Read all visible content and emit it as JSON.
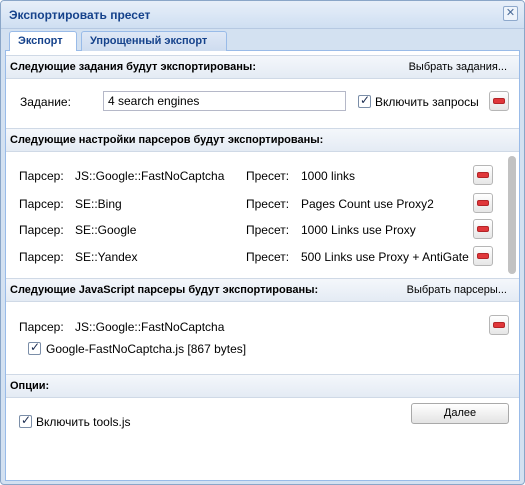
{
  "window": {
    "title": "Экспортировать пресет",
    "close_glyph": "✕"
  },
  "tabs": [
    {
      "label": "Экспорт",
      "active": true
    },
    {
      "label": "Упрощенный экспорт",
      "active": false
    }
  ],
  "tasks_section": {
    "title": "Следующие задания будут экспортированы:",
    "link": "Выбрать задания...",
    "task_label": "Задание:",
    "task_value": "4 search engines",
    "include_requests_label": "Включить запросы",
    "include_requests_checked": true
  },
  "parsers_section": {
    "title": "Следующие настройки парсеров будут экспортированы:",
    "parser_label": "Парсер:",
    "preset_label": "Пресет:",
    "rows": [
      {
        "parser": "JS::Google::FastNoCaptcha",
        "preset": "1000 links"
      },
      {
        "parser": "SE::Bing",
        "preset": "Pages Count use Proxy2"
      },
      {
        "parser": "SE::Google",
        "preset": "1000 Links use Proxy"
      },
      {
        "parser": "SE::Yandex",
        "preset": "500 Links use Proxy + AntiGate"
      }
    ]
  },
  "js_section": {
    "title": "Следующие JavaScript парсеры будут экспортированы:",
    "link": "Выбрать парсеры...",
    "parser_label": "Парсер:",
    "parser_value": "JS::Google::FastNoCaptcha",
    "file_label": "Google-FastNoCaptcha.js [867 bytes]",
    "file_checked": true
  },
  "options_section": {
    "title": "Опции:",
    "tools_label": "Включить tools.js",
    "tools_checked": true
  },
  "footer": {
    "next_label": "Далее"
  },
  "colors": {
    "header_text": "#15428b",
    "remove_red": "#e0373a",
    "border_blue": "#99bbe8"
  }
}
